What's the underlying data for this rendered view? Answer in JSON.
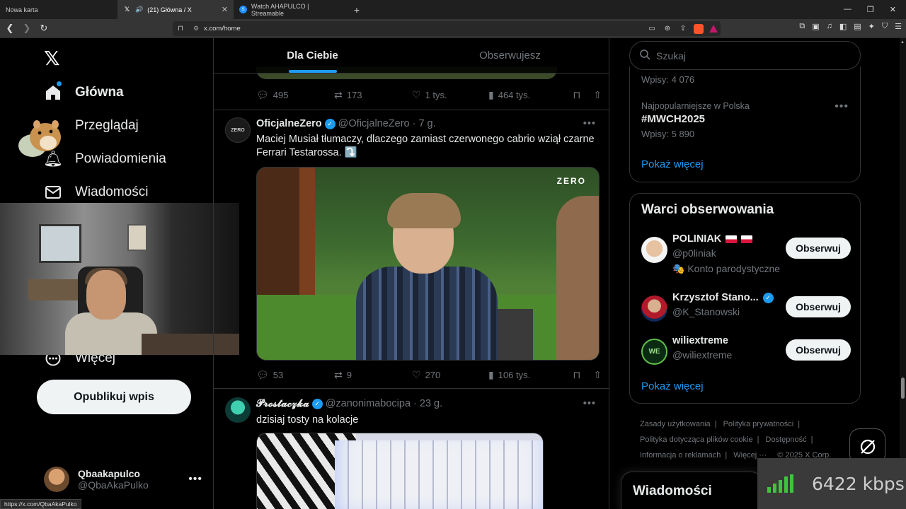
{
  "browser": {
    "tabs": [
      {
        "label": "Nowa karta"
      },
      {
        "label": "(21) Główna / X"
      },
      {
        "label": "Watch AHAPULCO | Streamable"
      }
    ],
    "url": "x.com/home",
    "status_url": "https://x.com/QbaAkaPulko"
  },
  "sidebar": {
    "items": [
      {
        "label": "Główna",
        "icon": "home-icon"
      },
      {
        "label": "Przeglądaj",
        "icon": "search-icon"
      },
      {
        "label": "Powiadomienia",
        "icon": "bell-icon"
      },
      {
        "label": "Wiadomości",
        "icon": "envelope-icon"
      },
      {
        "label": "Więcej",
        "icon": "more-circle-icon"
      }
    ],
    "publish_label": "Opublikuj wpis",
    "account": {
      "name": "Qbaakapulco",
      "handle": "@QbaAkaPulko"
    }
  },
  "feed": {
    "tabs": [
      {
        "label": "Dla Ciebie",
        "active": true
      },
      {
        "label": "Obserwujesz",
        "active": false
      }
    ],
    "prev_actions": {
      "replies": "495",
      "reposts": "173",
      "likes": "1 tys.",
      "views": "464 tys."
    },
    "posts": [
      {
        "name": "OficjalneZero",
        "handle": "@OficjalneZero",
        "time": "7 g.",
        "text": "Maciej Musiał tłumaczy, dlaczego zamiast czerwonego cabrio wziął czarne Ferrari Testarossa. ⤵️",
        "media_logo": "ZERO",
        "actions": {
          "replies": "53",
          "reposts": "9",
          "likes": "270",
          "views": "106 tys."
        }
      },
      {
        "name": "𝓟𝓻𝓸𝓼𝓽𝓪𝓬𝔃𝓴𝓪",
        "handle": "@zanonimabocipa",
        "time": "23 g.",
        "text": "dzisiaj tosty na kolacje"
      }
    ]
  },
  "right": {
    "search_placeholder": "Szukaj",
    "trends": {
      "first_posts": "Wpisy: 4 076",
      "context": "Najpopularniejsze w Polska",
      "name": "#MWCH2025",
      "posts": "Wpisy: 5 890",
      "show_more": "Pokaż więcej"
    },
    "who_to_follow": {
      "title": "Warci obserwowania",
      "users": [
        {
          "name": "POLINIAK",
          "handle": "@p0liniak",
          "extra": "🎭 Konto parodystyczne",
          "button": "Obserwuj"
        },
        {
          "name": "Krzysztof Stano...",
          "handle": "@K_Stanowski",
          "button": "Obserwuj"
        },
        {
          "name": "wiliextreme",
          "handle": "@wiliextreme",
          "button": "Obserwuj"
        }
      ],
      "show_more": "Pokaż więcej"
    },
    "footer": [
      "Zasady użytkowania",
      "Polityka prywatności",
      "Polityka dotycząca plików cookie",
      "Dostępność",
      "Informacja o reklamach",
      "Więcej ···",
      "© 2025 X Corp."
    ],
    "messages_label": "Wiadomości"
  },
  "overlay": {
    "bitrate": "6422 kbps"
  },
  "colors": {
    "accent": "#1d9bf0",
    "background": "#000000",
    "border": "#2f3336"
  }
}
